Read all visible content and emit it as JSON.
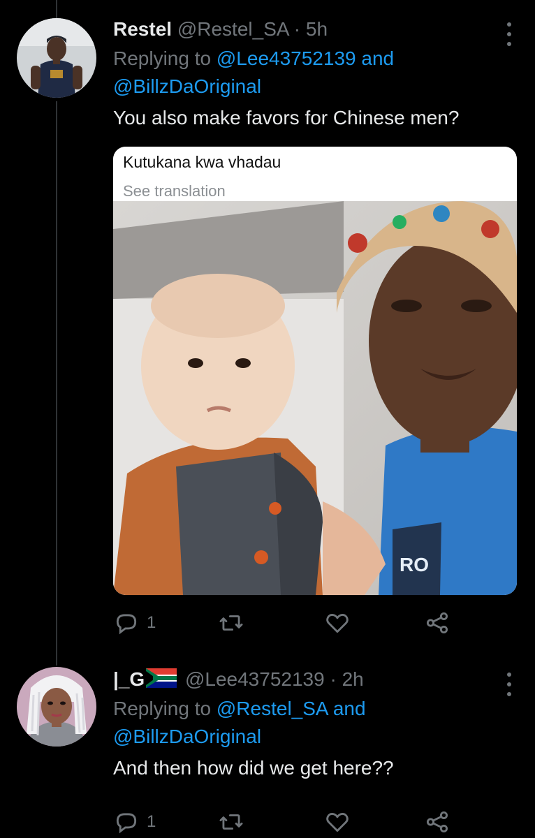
{
  "tweets": [
    {
      "name": "Restel",
      "handle": "@Restel_SA",
      "separator": "·",
      "time": "5h",
      "replying_prefix": "Replying to",
      "replying_user1": "@Lee43752139",
      "replying_and": "and",
      "replying_user2": "@BillzDaOriginal",
      "text": "You also make favors for Chinese men?",
      "media": {
        "caption": "Kutukana kwa vhadau",
        "translate_link": "See translation",
        "jersey_text": "RO"
      },
      "actions": {
        "reply_count": "1"
      }
    },
    {
      "name": "|_G",
      "flag": "south-africa-flag",
      "handle": "@Lee43752139",
      "separator": "·",
      "time": "2h",
      "replying_prefix": "Replying to",
      "replying_user1": "@Restel_SA",
      "replying_and": "and",
      "replying_user2": "@BillzDaOriginal",
      "text": "And then how did we get here??",
      "actions": {
        "reply_count": "1"
      }
    }
  ],
  "colors": {
    "background": "#000000",
    "link": "#1d9bf0",
    "muted": "#71767b",
    "text": "#e7e9ea"
  }
}
